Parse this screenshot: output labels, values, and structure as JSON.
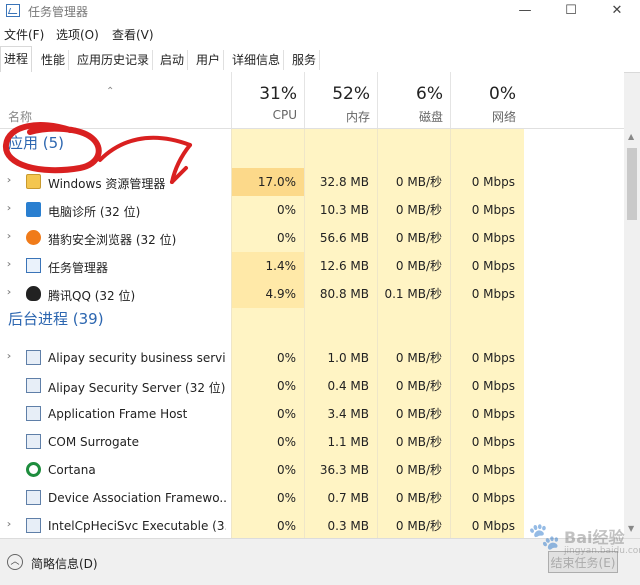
{
  "window": {
    "title": "任务管理器",
    "controls": [
      "—",
      "☐",
      "✕"
    ]
  },
  "menu": [
    "文件(F)",
    "选项(O)",
    "查看(V)"
  ],
  "tabs": [
    "进程",
    "性能",
    "应用历史记录",
    "启动",
    "用户",
    "详细信息",
    "服务"
  ],
  "active_tab": "进程",
  "header": {
    "name_label": "名称",
    "columns": [
      {
        "pct": "31%",
        "label": "CPU"
      },
      {
        "pct": "52%",
        "label": "内存"
      },
      {
        "pct": "6%",
        "label": "磁盘"
      },
      {
        "pct": "0%",
        "label": "网络"
      }
    ]
  },
  "groups": [
    {
      "title": "应用 (5)",
      "rows": [
        {
          "name": "Windows 资源管理器",
          "cpu": "17.0%",
          "mem": "32.8 MB",
          "disk": "0 MB/秒",
          "net": "0 Mbps",
          "icon": "folder-icon",
          "expandable": true
        },
        {
          "name": "电脑诊所 (32 位)",
          "cpu": "0%",
          "mem": "10.3 MB",
          "disk": "0 MB/秒",
          "net": "0 Mbps",
          "icon": "monitor-icon",
          "expandable": true
        },
        {
          "name": "猎豹安全浏览器 (32 位)",
          "cpu": "0%",
          "mem": "56.6 MB",
          "disk": "0 MB/秒",
          "net": "0 Mbps",
          "icon": "browser-icon",
          "expandable": true
        },
        {
          "name": "任务管理器",
          "cpu": "1.4%",
          "mem": "12.6 MB",
          "disk": "0 MB/秒",
          "net": "0 Mbps",
          "icon": "task-manager-icon",
          "expandable": true
        },
        {
          "name": "腾讯QQ (32 位)",
          "cpu": "4.9%",
          "mem": "80.8 MB",
          "disk": "0.1 MB/秒",
          "net": "0 Mbps",
          "icon": "penguin-icon",
          "expandable": true
        }
      ]
    },
    {
      "title": "后台进程 (39)",
      "rows": [
        {
          "name": "Alipay security business servi...",
          "cpu": "0%",
          "mem": "1.0 MB",
          "disk": "0 MB/秒",
          "net": "0 Mbps",
          "icon": "service-icon",
          "expandable": true
        },
        {
          "name": "Alipay Security Server (32 位)",
          "cpu": "0%",
          "mem": "0.4 MB",
          "disk": "0 MB/秒",
          "net": "0 Mbps",
          "icon": "service-icon",
          "expandable": false
        },
        {
          "name": "Application Frame Host",
          "cpu": "0%",
          "mem": "3.4 MB",
          "disk": "0 MB/秒",
          "net": "0 Mbps",
          "icon": "service-icon",
          "expandable": false
        },
        {
          "name": "COM Surrogate",
          "cpu": "0%",
          "mem": "1.1 MB",
          "disk": "0 MB/秒",
          "net": "0 Mbps",
          "icon": "service-icon",
          "expandable": false
        },
        {
          "name": "Cortana",
          "cpu": "0%",
          "mem": "36.3 MB",
          "disk": "0 MB/秒",
          "net": "0 Mbps",
          "icon": "cortana-icon",
          "expandable": false
        },
        {
          "name": "Device Association Framewo...",
          "cpu": "0%",
          "mem": "0.7 MB",
          "disk": "0 MB/秒",
          "net": "0 Mbps",
          "icon": "service-icon",
          "expandable": false
        },
        {
          "name": "IntelCpHeciSvc Executable (3...",
          "cpu": "0%",
          "mem": "0.3 MB",
          "disk": "0 MB/秒",
          "net": "0 Mbps",
          "icon": "service-icon",
          "expandable": true
        }
      ]
    }
  ],
  "footer": {
    "fewer_details": "简略信息(D)",
    "end_task": "结束任务(E)"
  },
  "watermark": {
    "text": "Bai经验",
    "url": "jingyan.baidu.com"
  },
  "colors": {
    "heat_light": "#fff4c4",
    "heat_mid": "#ffe9a8",
    "heat_high": "#fcd98a",
    "group_blue": "#2c66b0",
    "annotation_red": "#d92020"
  }
}
